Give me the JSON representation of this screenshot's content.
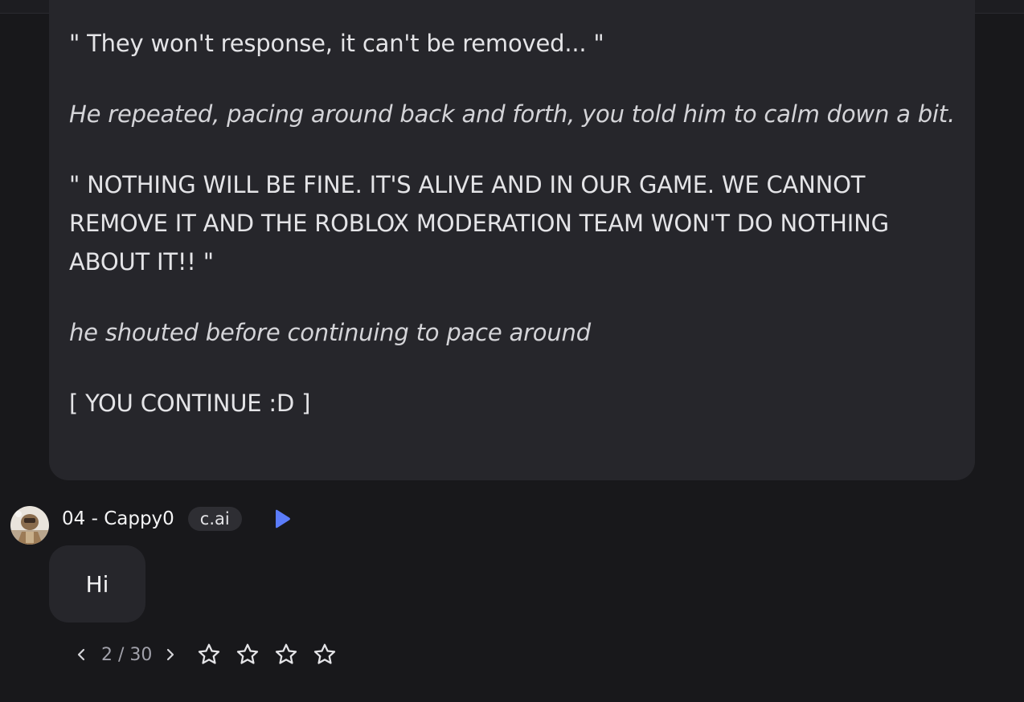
{
  "message": {
    "paragraphs": [
      {
        "style": "normal",
        "text": "\" They won't response, it can't be removed... \""
      },
      {
        "style": "italic",
        "text": "He repeated, pacing around back and forth, you told him to calm down a bit."
      },
      {
        "style": "normal",
        "text": "\" NOTHING WILL BE FINE. IT'S ALIVE AND IN OUR GAME. WE CANNOT REMOVE IT AND THE ROBLOX MODERATION TEAM WON'T DO NOTHING ABOUT IT!! \""
      },
      {
        "style": "italic",
        "text": "he shouted before continuing to pace around"
      },
      {
        "style": "normal",
        "text": "[ YOU CONTINUE :D ]"
      }
    ]
  },
  "reply": {
    "author": "04 - Cappy0",
    "badge": "c.ai",
    "text": "Hi",
    "avatar_icon": "character-avatar",
    "play_icon": "play-icon",
    "accent_color": "#5b7cfa"
  },
  "pager": {
    "current": "2",
    "total": "30",
    "label": "2 / 30"
  },
  "rating": {
    "stars_filled": 0,
    "stars_total": 4
  }
}
